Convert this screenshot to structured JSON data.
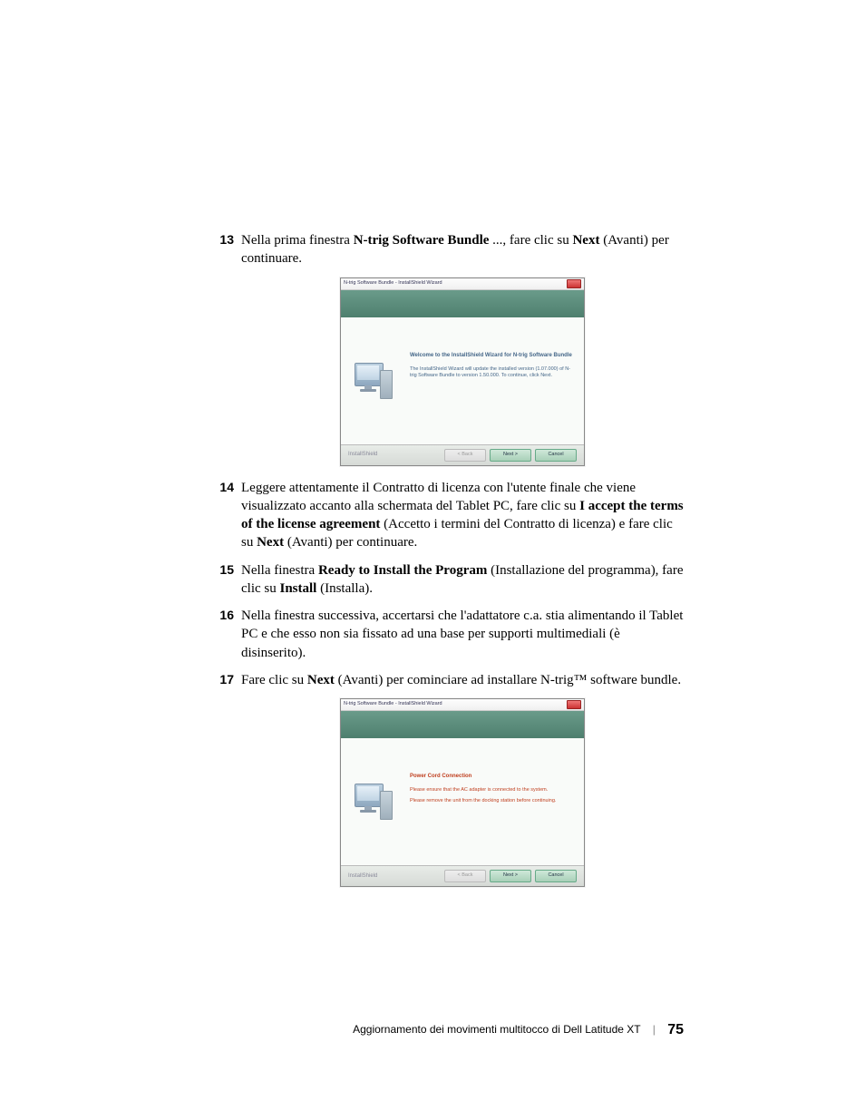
{
  "steps": {
    "s13": {
      "num": "13",
      "t1": "Nella prima finestra ",
      "b1": "N-trig Software Bundle",
      "t2": " ..., fare clic su ",
      "b2": "Next",
      "t3": " (Avanti) per continuare."
    },
    "s14": {
      "num": "14",
      "t1": "Leggere attentamente il Contratto di licenza con l'utente finale che viene visualizzato accanto alla schermata del Tablet PC, fare clic su ",
      "b1": "I accept the terms of the license agreement",
      "t2": " (Accetto i termini del Contratto di licenza) e fare clic su ",
      "b2": "Next",
      "t3": " (Avanti) per continuare."
    },
    "s15": {
      "num": "15",
      "t1": "Nella finestra ",
      "b1": "Ready to Install the Program",
      "t2": " (Installazione del programma), fare clic su ",
      "b2": "Install",
      "t3": " (Installa)."
    },
    "s16": {
      "num": "16",
      "t1": "Nella finestra successiva, accertarsi che l'adattatore c.a. stia alimentando il Tablet PC e che esso non sia fissato ad una base per supporti multimediali (è disinserito)."
    },
    "s17": {
      "num": "17",
      "t1": "Fare clic su ",
      "b1": "Next",
      "t2": " (Avanti) per cominciare ad installare N-trig™ software bundle."
    }
  },
  "wizard1": {
    "title": "N-trig Software Bundle - InstallShield Wizard",
    "heading": "Welcome to the InstallShield Wizard for N-trig Software Bundle",
    "line1": "The InstallShield Wizard will update the installed version (1.07.000) of N-trig Software Bundle to version 1.50.000. To continue, click Next.",
    "brand": "InstallShield",
    "back": "< Back",
    "next": "Next >",
    "cancel": "Cancel"
  },
  "wizard2": {
    "title": "N-trig Software Bundle - InstallShield Wizard",
    "heading": "Power Cord Connection",
    "line1": "Please ensure that the AC adapter is connected to the system.",
    "line2": "Please remove the unit from the docking station before continuing.",
    "brand": "InstallShield",
    "back": "< Back",
    "next": "Next >",
    "cancel": "Cancel"
  },
  "footer": {
    "text": "Aggiornamento dei movimenti multitocco di Dell Latitude XT",
    "page": "75"
  }
}
